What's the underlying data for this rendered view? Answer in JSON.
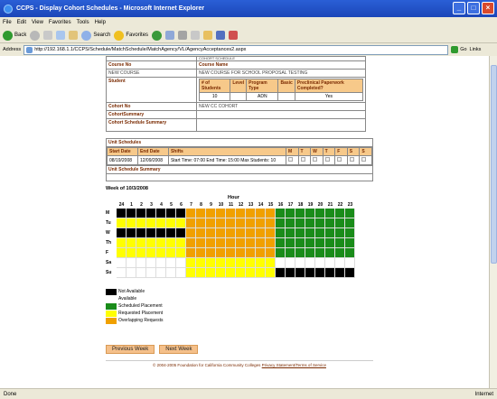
{
  "window": {
    "title": "CCPS - Display Cohort Schedules - Microsoft Internet Explorer"
  },
  "menu": [
    "File",
    "Edit",
    "View",
    "Favorites",
    "Tools",
    "Help"
  ],
  "toolbar": {
    "back": "Back",
    "search": "Search",
    "favorites": "Favorites"
  },
  "address": {
    "label": "Address",
    "url": "http://192.168.1.1/CCPS/Schedule/MatchSchedule/MatchAgency/VL/AgencyAcceptances2.aspx",
    "go": "Go",
    "links": "Links"
  },
  "info": {
    "top_cut": "COHORT SCHEDULE",
    "course_no_label": "Course No",
    "course_name_label": "Course Name",
    "course_no": "NEW COURSE",
    "course_name": "NEW COURSE FOR SCHOOL PROPOSAL TESTING",
    "student_label": "Student",
    "student_cols": [
      "# of Students",
      "Level",
      "Program Type",
      "Basic",
      "Preclinical Paperwork Completed?"
    ],
    "student_vals": [
      "10",
      "",
      "ADN",
      "",
      "Yes"
    ],
    "cohort_no_label": "Cohort No",
    "cohort_no": "NEW CC COHORT",
    "cohort_summary_label": "CohortSummary",
    "cohort_schedule_summary_label": "Cohort Schedule Summary"
  },
  "unit": {
    "title": "Unit Schedules",
    "headers": [
      "Start Date",
      "End Date",
      "Shifts",
      "M",
      "T",
      "W",
      "T",
      "F",
      "S",
      "S"
    ],
    "row": {
      "start": "08/19/2008",
      "end": "12/09/2008",
      "shifts": "Start Time: 07:00 End Time: 15:00 Max Students: 10"
    },
    "summary_label": "Unit Schedule Summary"
  },
  "week_label": "Week of 10/3/2008",
  "grid": {
    "hour_label": "Hour",
    "hours": [
      "24",
      "1",
      "2",
      "3",
      "4",
      "5",
      "6",
      "7",
      "8",
      "9",
      "10",
      "11",
      "12",
      "13",
      "14",
      "15",
      "16",
      "17",
      "18",
      "19",
      "20",
      "21",
      "22",
      "23"
    ],
    "days": [
      {
        "name": "M",
        "cells": "bbbbbbboooooooooggggggggww"
      },
      {
        "name": "Tu",
        "cells": "yyyyyyyoooooooooggggggggyy"
      },
      {
        "name": "W",
        "cells": "bbbbbbboooooooooggggggggww"
      },
      {
        "name": "Th",
        "cells": "yyyyyyyoooooooooggggggggyy"
      },
      {
        "name": "F",
        "cells": "yyyyyyyoooooooooggggggggyy"
      },
      {
        "name": "Sa",
        "cells": "wwwwwwwyyyyyyyyywwwwwwwwww"
      },
      {
        "name": "Su",
        "cells": "wwwwwwwyyyyyyyyybbbbbbbbbb"
      }
    ]
  },
  "legend": [
    {
      "label": "Not Available",
      "color": "#000000"
    },
    {
      "label": "Available",
      "color": "#ffffff"
    },
    {
      "label": "Scheduled Placement",
      "color": "#1a8c1a"
    },
    {
      "label": "Requested Placement",
      "color": "#ffff00"
    },
    {
      "label": "Overlapping Requests",
      "color": "#f0a000"
    }
  ],
  "buttons": {
    "prev": "Previous Week",
    "next": "Next Week"
  },
  "footer": {
    "text": "© 2004-2005 Foundation for California Community Colleges  ",
    "link": "Privacy Statement/Terms of Service"
  },
  "status": {
    "left": "Done",
    "right": "Internet"
  }
}
